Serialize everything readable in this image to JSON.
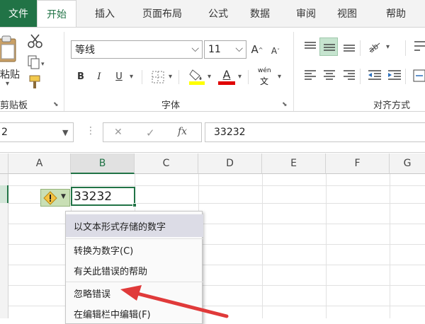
{
  "tabs": {
    "file": "文件",
    "items": [
      "开始",
      "插入",
      "页面布局",
      "公式",
      "数据",
      "审阅",
      "视图",
      "帮助"
    ]
  },
  "ribbon": {
    "clipboard": {
      "paste_label": "粘贴",
      "group_label": "剪贴板"
    },
    "font": {
      "font_name": "等线",
      "font_size": "11",
      "bold": "B",
      "italic": "I",
      "underline": "U",
      "phonetic_top": "wén",
      "phonetic_bottom": "文",
      "grow": "A",
      "shrink": "A",
      "font_color_letter": "A",
      "group_label": "字体"
    },
    "alignment": {
      "group_label": "对齐方式"
    }
  },
  "formula_bar": {
    "name_box": "2",
    "cancel": "✕",
    "enter": "✓",
    "fx": "fx",
    "content": "33232"
  },
  "grid": {
    "columns": [
      "A",
      "B",
      "C",
      "D",
      "E",
      "F",
      "G"
    ],
    "active_cell_value": "33232"
  },
  "error_menu": {
    "items": [
      "以文本形式存储的数字",
      "转换为数字(C)",
      "有关此错误的帮助",
      "忽略错误",
      "在编辑栏中编辑(F)"
    ]
  },
  "colors": {
    "accent_green": "#217346",
    "annotation_arrow": "#e03a3a",
    "menu_highlight": "#dcdce6"
  }
}
